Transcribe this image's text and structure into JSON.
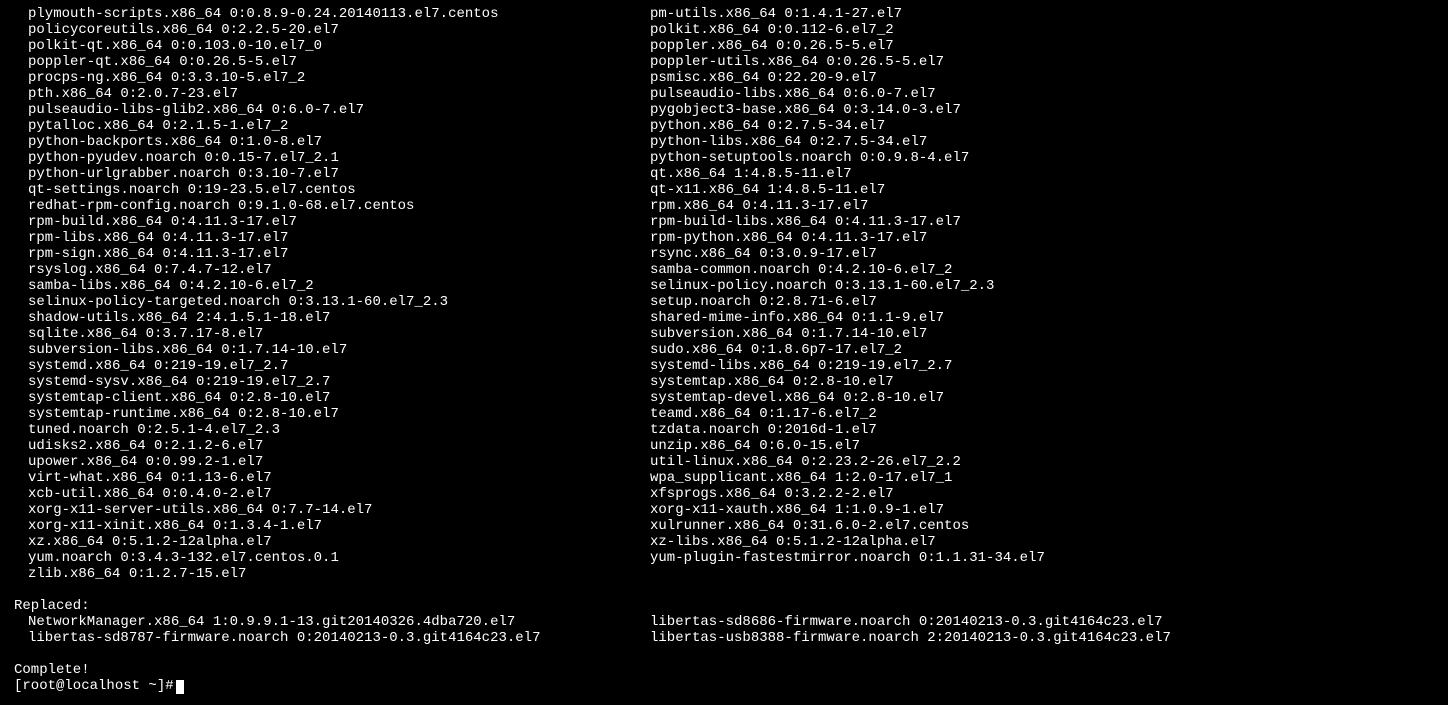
{
  "packages_left": [
    "plymouth-scripts.x86_64 0:0.8.9-0.24.20140113.el7.centos",
    "policycoreutils.x86_64 0:2.2.5-20.el7",
    "polkit-qt.x86_64 0:0.103.0-10.el7_0",
    "poppler-qt.x86_64 0:0.26.5-5.el7",
    "procps-ng.x86_64 0:3.3.10-5.el7_2",
    "pth.x86_64 0:2.0.7-23.el7",
    "pulseaudio-libs-glib2.x86_64 0:6.0-7.el7",
    "pytalloc.x86_64 0:2.1.5-1.el7_2",
    "python-backports.x86_64 0:1.0-8.el7",
    "python-pyudev.noarch 0:0.15-7.el7_2.1",
    "python-urlgrabber.noarch 0:3.10-7.el7",
    "qt-settings.noarch 0:19-23.5.el7.centos",
    "redhat-rpm-config.noarch 0:9.1.0-68.el7.centos",
    "rpm-build.x86_64 0:4.11.3-17.el7",
    "rpm-libs.x86_64 0:4.11.3-17.el7",
    "rpm-sign.x86_64 0:4.11.3-17.el7",
    "rsyslog.x86_64 0:7.4.7-12.el7",
    "samba-libs.x86_64 0:4.2.10-6.el7_2",
    "selinux-policy-targeted.noarch 0:3.13.1-60.el7_2.3",
    "shadow-utils.x86_64 2:4.1.5.1-18.el7",
    "sqlite.x86_64 0:3.7.17-8.el7",
    "subversion-libs.x86_64 0:1.7.14-10.el7",
    "systemd.x86_64 0:219-19.el7_2.7",
    "systemd-sysv.x86_64 0:219-19.el7_2.7",
    "systemtap-client.x86_64 0:2.8-10.el7",
    "systemtap-runtime.x86_64 0:2.8-10.el7",
    "tuned.noarch 0:2.5.1-4.el7_2.3",
    "udisks2.x86_64 0:2.1.2-6.el7",
    "upower.x86_64 0:0.99.2-1.el7",
    "virt-what.x86_64 0:1.13-6.el7",
    "xcb-util.x86_64 0:0.4.0-2.el7",
    "xorg-x11-server-utils.x86_64 0:7.7-14.el7",
    "xorg-x11-xinit.x86_64 0:1.3.4-1.el7",
    "xz.x86_64 0:5.1.2-12alpha.el7",
    "yum.noarch 0:3.4.3-132.el7.centos.0.1",
    "zlib.x86_64 0:1.2.7-15.el7"
  ],
  "packages_right": [
    "pm-utils.x86_64 0:1.4.1-27.el7",
    "polkit.x86_64 0:0.112-6.el7_2",
    "poppler.x86_64 0:0.26.5-5.el7",
    "poppler-utils.x86_64 0:0.26.5-5.el7",
    "psmisc.x86_64 0:22.20-9.el7",
    "pulseaudio-libs.x86_64 0:6.0-7.el7",
    "pygobject3-base.x86_64 0:3.14.0-3.el7",
    "python.x86_64 0:2.7.5-34.el7",
    "python-libs.x86_64 0:2.7.5-34.el7",
    "python-setuptools.noarch 0:0.9.8-4.el7",
    "qt.x86_64 1:4.8.5-11.el7",
    "qt-x11.x86_64 1:4.8.5-11.el7",
    "rpm.x86_64 0:4.11.3-17.el7",
    "rpm-build-libs.x86_64 0:4.11.3-17.el7",
    "rpm-python.x86_64 0:4.11.3-17.el7",
    "rsync.x86_64 0:3.0.9-17.el7",
    "samba-common.noarch 0:4.2.10-6.el7_2",
    "selinux-policy.noarch 0:3.13.1-60.el7_2.3",
    "setup.noarch 0:2.8.71-6.el7",
    "shared-mime-info.x86_64 0:1.1-9.el7",
    "subversion.x86_64 0:1.7.14-10.el7",
    "sudo.x86_64 0:1.8.6p7-17.el7_2",
    "systemd-libs.x86_64 0:219-19.el7_2.7",
    "systemtap.x86_64 0:2.8-10.el7",
    "systemtap-devel.x86_64 0:2.8-10.el7",
    "teamd.x86_64 0:1.17-6.el7_2",
    "tzdata.noarch 0:2016d-1.el7",
    "unzip.x86_64 0:6.0-15.el7",
    "util-linux.x86_64 0:2.23.2-26.el7_2.2",
    "wpa_supplicant.x86_64 1:2.0-17.el7_1",
    "xfsprogs.x86_64 0:3.2.2-2.el7",
    "xorg-x11-xauth.x86_64 1:1.0.9-1.el7",
    "xulrunner.x86_64 0:31.6.0-2.el7.centos",
    "xz-libs.x86_64 0:5.1.2-12alpha.el7",
    "yum-plugin-fastestmirror.noarch 0:1.1.31-34.el7"
  ],
  "replaced_header": "Replaced:",
  "replaced_left": [
    "NetworkManager.x86_64 1:0.9.9.1-13.git20140326.4dba720.el7",
    "libertas-sd8787-firmware.noarch 0:20140213-0.3.git4164c23.el7"
  ],
  "replaced_right": [
    "libertas-sd8686-firmware.noarch 0:20140213-0.3.git4164c23.el7",
    "libertas-usb8388-firmware.noarch 2:20140213-0.3.git4164c23.el7"
  ],
  "complete": "Complete!",
  "prompt": "[root@localhost ~]#"
}
